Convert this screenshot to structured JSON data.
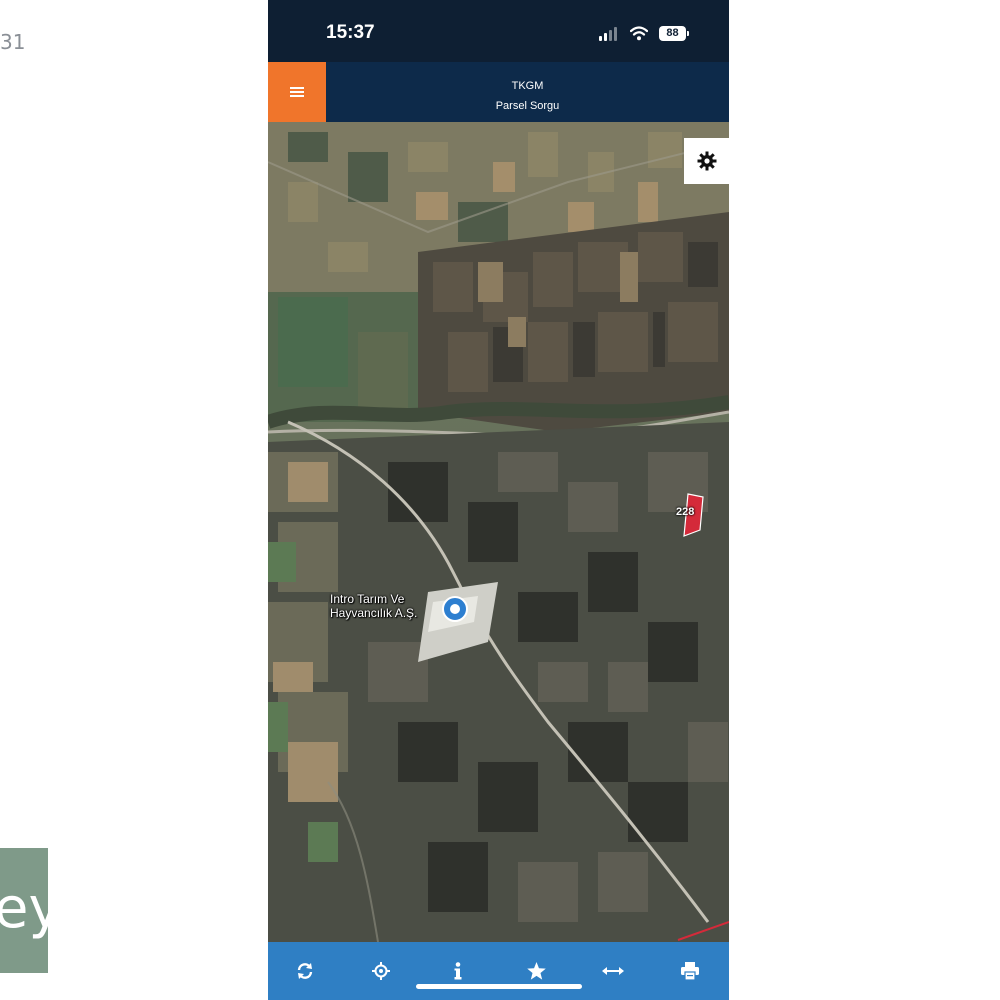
{
  "left_fragment_text": "31",
  "left_logo_text": "ey",
  "status_bar": {
    "time": "15:37",
    "battery": "88"
  },
  "header": {
    "line1": "TKGM",
    "line2": "Parsel Sorgu",
    "accent_color": "#f0752b",
    "bar_color": "#0d2a4a"
  },
  "map": {
    "place_label_line1": "Intro Tarım Ve",
    "place_label_line2": "Hayvancılık A.Ş.",
    "parcel_label": "228",
    "parcel_color": "#d42a3a"
  },
  "toolbar": {
    "bar_color": "#2f7fc4",
    "icons": [
      "refresh-icon",
      "locate-icon",
      "info-icon",
      "star-icon",
      "measure-icon",
      "print-icon"
    ]
  }
}
